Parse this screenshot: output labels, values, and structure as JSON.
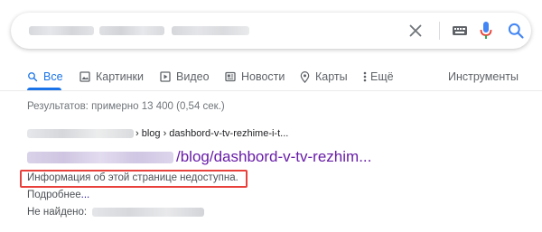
{
  "tabs": {
    "all": "Все",
    "images": "Картинки",
    "videos": "Видео",
    "news": "Новости",
    "maps": "Карты",
    "more": "Ещё",
    "tools": "Инструменты"
  },
  "stats": "Результатов: примерно 13 400 (0,54 сек.)",
  "result": {
    "crumb_path": "› blog › dashbord-v-tv-rezhime-i-t...",
    "title_tail": "/blog/dashbord-v-tv-rezhim...",
    "notice": "Информация об этой странице недоступна.",
    "more_label": "Подробнее",
    "more_dots": "...",
    "not_found_label": "Не найдено:"
  },
  "colors": {
    "accent": "#1a73e8",
    "visited_link": "#681da8",
    "highlight_box": "#e8413c",
    "mic_blue": "#4285f4",
    "mic_red": "#ea4335"
  },
  "icons": [
    "search-icon",
    "clear-icon",
    "keyboard-icon",
    "mic-icon",
    "images-icon",
    "video-icon",
    "news-icon",
    "map-pin-icon",
    "more-dots-icon"
  ]
}
